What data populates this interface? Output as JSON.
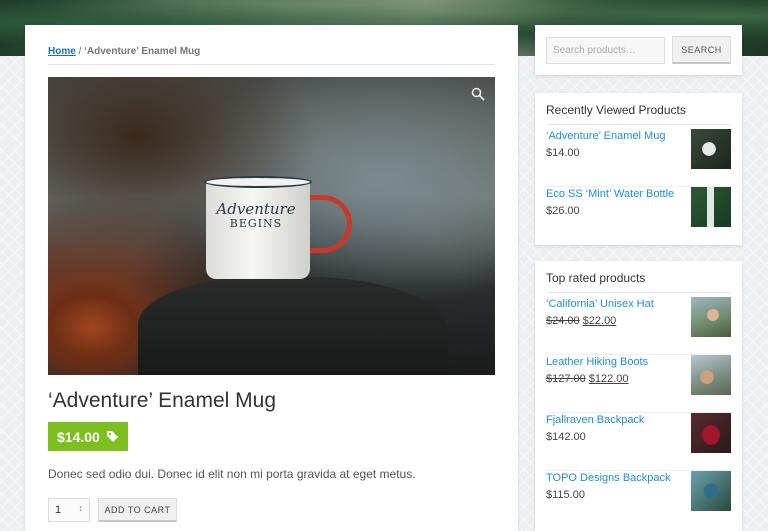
{
  "breadcrumb": {
    "home": "Home",
    "separator": "/",
    "current": "‘Adventure’ Enamel Mug"
  },
  "product": {
    "title": "‘Adventure’ Enamel Mug",
    "price": "$14.00",
    "description": "Donec sed odio dui. Donec id elit non mi porta gravida at eget metus.",
    "quantity": "1",
    "add_to_cart": "ADD TO CART",
    "image_icon": "zoom-icon",
    "price_icon": "tag-icon",
    "accent_color": "#7cbf1e"
  },
  "search": {
    "placeholder": "Search products…",
    "button": "SEARCH"
  },
  "recently_viewed": {
    "title": "Recently Viewed Products",
    "items": [
      {
        "name": "‘Adventure’ Enamel Mug",
        "price": "$14.00"
      },
      {
        "name": "Eco SS ‘Mint’ Water Bottle",
        "price": "$26.00"
      }
    ]
  },
  "top_rated": {
    "title": "Top rated products",
    "items": [
      {
        "name": "‘California’ Unisex Hat",
        "old_price": "$24.00",
        "price": "$22.00"
      },
      {
        "name": "Leather Hiking Boots",
        "old_price": "$127.00",
        "price": "$122.00"
      },
      {
        "name": "Fjallraven Backpack",
        "price": "$142.00"
      },
      {
        "name": "TOPO Designs Backpack",
        "price": "$115.00"
      }
    ]
  },
  "colors": {
    "link": "#1e8fd6",
    "breadcrumb_link": "#1a6fb5"
  }
}
